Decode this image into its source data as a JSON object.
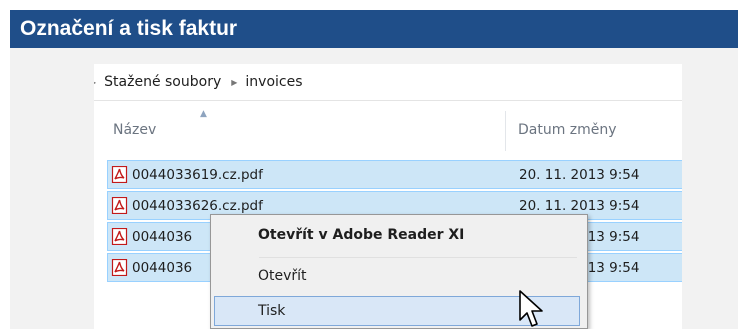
{
  "title": "Označení a tisk faktur",
  "breadcrumb": {
    "items": [
      "Stažené soubory",
      "invoices"
    ]
  },
  "columns": {
    "name": "Název",
    "date": "Datum změny"
  },
  "files": [
    {
      "name": "0044033619.cz.pdf",
      "date": "20. 11. 2013 9:54"
    },
    {
      "name": "0044033626.cz.pdf",
      "date": "20. 11. 2013 9:54"
    },
    {
      "name": "0044036",
      "date": "20. 11. 2013 9:54"
    },
    {
      "name": "0044036",
      "date": "20. 11. 2013 9:54"
    }
  ],
  "context_menu": {
    "items": [
      {
        "label": "Otevřít v Adobe Reader XI"
      },
      {
        "label": "Otevřít"
      },
      {
        "label": "Tisk"
      }
    ]
  },
  "colors": {
    "title_bg": "#1f4e89",
    "selection_bg": "#cde6f7",
    "selection_border": "#99d1ff",
    "menu_hover": "#d9e7f7",
    "pdf_icon": "#c21a1a"
  }
}
